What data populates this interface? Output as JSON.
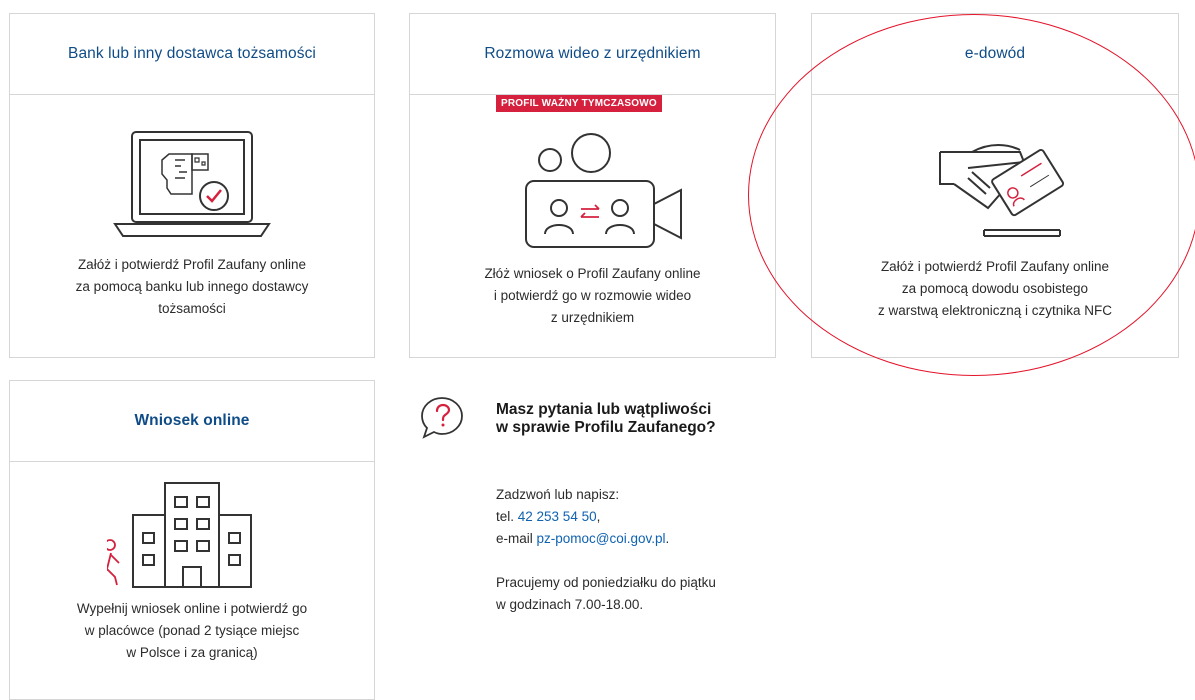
{
  "cards": [
    {
      "title": "Bank lub inny dostawca tożsamości",
      "icon": "laptop-identity-check-icon",
      "desc": [
        "Załóż i potwierdź Profil Zaufany online",
        "za pomocą banku lub innego dostawcy",
        "tożsamości"
      ]
    },
    {
      "title": "Rozmowa wideo z urzędnikiem",
      "badge": "PROFIL WAŻNY TYMCZASOWO",
      "icon": "video-call-camera-icon",
      "desc": [
        "Złóż wniosek o Profil Zaufany online",
        "i potwierdź go w rozmowie wideo",
        "z urzędnikiem"
      ]
    },
    {
      "title": "e-dowód",
      "icon": "hand-id-card-icon",
      "desc": [
        "Załóż i potwierdź Profil Zaufany online",
        "za pomocą dowodu osobistego",
        "z warstwą elektroniczną i czytnika NFC"
      ]
    },
    {
      "title": "Wniosek online",
      "icon": "office-building-walking-person-icon",
      "desc": [
        "Wypełnij wniosek online i potwierdź go",
        "w placówce (ponad 2 tysiące miejsc",
        "w Polsce i za granicą)"
      ]
    }
  ],
  "contact": {
    "icon": "question-bubble-icon",
    "title_lines": [
      "Masz pytania lub wątpliwości",
      "w sprawie Profilu Zaufanego?"
    ],
    "intro": "Zadzwoń lub napisz:",
    "phone_prefix": "tel. ",
    "phone": "42 253 54 50",
    "phone_suffix": ",",
    "email_prefix": "e-mail ",
    "email": "pz-pomoc@coi.gov.pl",
    "email_suffix": ".",
    "hours": [
      "Pracujemy od poniedziałku do piątku",
      "w godzinach 7.00-18.00."
    ]
  },
  "colors": {
    "title_blue": "#0f4c87",
    "link_blue": "#0f62b0",
    "accent_red": "#d6213e",
    "annotation_red": "#e3132a",
    "border": "#d6d6d6"
  }
}
